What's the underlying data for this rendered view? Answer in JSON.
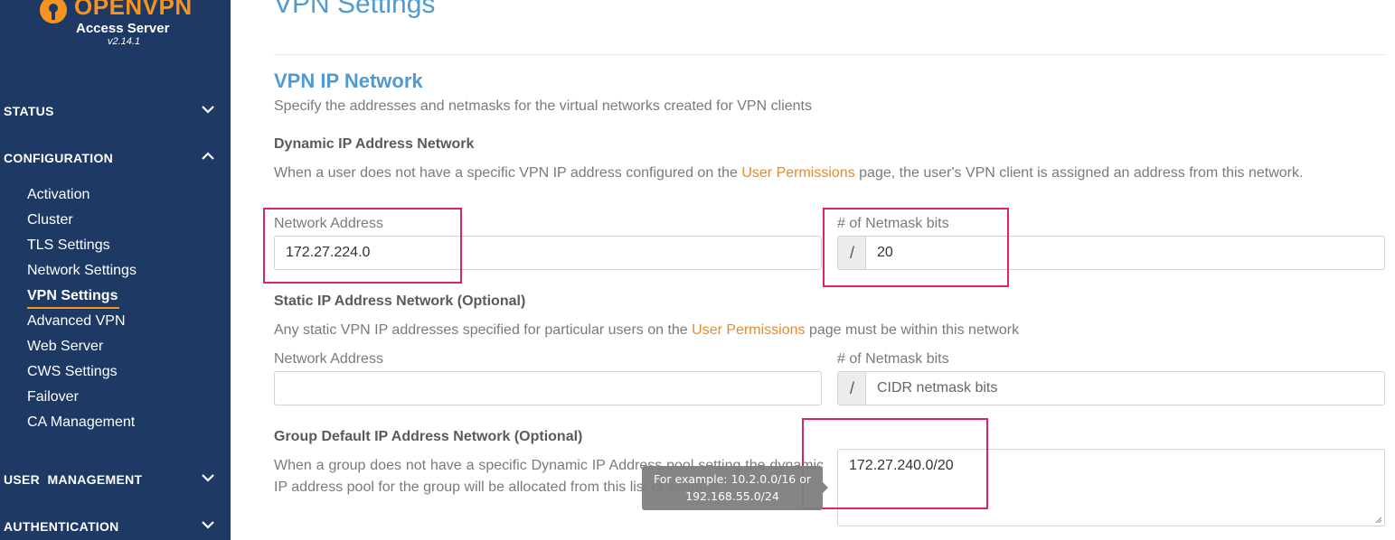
{
  "sidebar": {
    "logo": {
      "title": "OPENVPN",
      "subtitle": "Access Server",
      "version": "v2.14.1"
    },
    "sections": [
      {
        "label": "STATUS",
        "icon": "chevron-down-icon"
      },
      {
        "label": "CONFIGURATION",
        "icon": "chevron-up-icon"
      },
      {
        "label": "USER  MANAGEMENT",
        "icon": "chevron-down-icon"
      },
      {
        "label": "AUTHENTICATION",
        "icon": "chevron-down-icon"
      }
    ],
    "config_items": [
      "Activation",
      "Cluster",
      "TLS Settings",
      "Network Settings",
      "VPN Settings",
      "Advanced VPN",
      "Web Server",
      "CWS Settings",
      "Failover",
      "CA Management"
    ],
    "active_item": "VPN Settings"
  },
  "main": {
    "page_title": "VPN Settings",
    "section_title": "VPN IP Network",
    "section_desc": "Specify the addresses and netmasks for the virtual networks created for VPN clients",
    "dynamic": {
      "heading": "Dynamic IP Address Network",
      "desc_before": "When a user does not have a specific VPN IP address configured on the ",
      "desc_link": "User Permissions",
      "desc_after": " page, the user's VPN client is assigned an address from this network.",
      "network_label": "Network Address",
      "network_value": "172.27.224.0",
      "netmask_label": "# of Netmask bits",
      "netmask_prefix": "/",
      "netmask_value": "20"
    },
    "static": {
      "heading": "Static IP Address Network (Optional)",
      "desc_before": "Any static VPN IP addresses specified for particular users on the ",
      "desc_link": "User Permissions",
      "desc_after": " page must be within this network",
      "network_label": "Network Address",
      "network_value": "",
      "netmask_label": "# of Netmask bits",
      "netmask_prefix": "/",
      "netmask_placeholder": "CIDR netmask bits"
    },
    "group": {
      "heading": "Group Default IP Address Network (Optional)",
      "desc": "When a group does not have a specific Dynamic IP Address pool setting the dynamic IP address pool for the group will be allocated from this list of subnets.",
      "value": "172.27.240.0/20"
    },
    "tooltip": {
      "line1": "For example: 10.2.0.0/16 or",
      "line2": "192.168.55.0/24"
    }
  },
  "colors": {
    "sidebar_bg": "#1d3964",
    "accent": "#f7931e",
    "title": "#4f9ad1",
    "link": "#e58a2a",
    "highlight": "#e0245e"
  }
}
